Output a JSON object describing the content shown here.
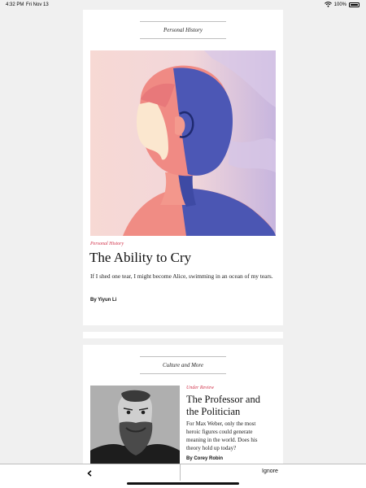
{
  "status_bar": {
    "time": "4:32 PM",
    "date": "Fri Nov 13",
    "battery": "100%",
    "icons": [
      "wifi-icon",
      "battery-icon"
    ]
  },
  "articles": [
    {
      "section": "Personal History",
      "kicker": "Personal History",
      "title": "The Ability to Cry",
      "dek": "If I shed one tear, I might become Alice, swimming in an ocean of my tears.",
      "byline": "By Yiyun Li"
    },
    {
      "section": "Culture and More",
      "kicker": "Under Review",
      "title_lines": [
        "The Professor and",
        "the Politician"
      ],
      "dek_lines": [
        "For Max Weber, only the most",
        "heroic figures could generate",
        "meaning in the world. Does his",
        "theory hold up today?"
      ],
      "byline": "By Corey Robin"
    }
  ],
  "toolbar": {
    "back_icon": "chevron-left-icon",
    "ignore_label": "Ignore"
  },
  "colors": {
    "accent": "#d1324a",
    "background": "#f0f0f0",
    "card": "#ffffff"
  }
}
